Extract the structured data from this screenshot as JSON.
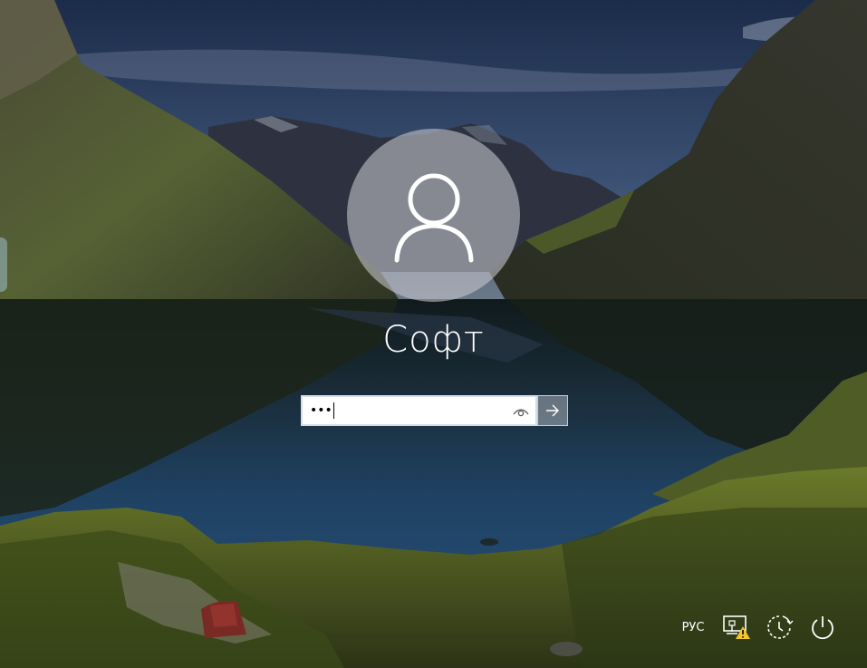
{
  "user": {
    "name": "Софт"
  },
  "password": {
    "masked_value": "•••",
    "reveal_icon": "eye-icon"
  },
  "submit": {
    "icon": "arrow-right-icon"
  },
  "tray": {
    "language": "РУС",
    "network_icon": "network-warning-icon",
    "accessibility_icon": "ease-of-access-icon",
    "power_icon": "power-icon"
  },
  "colors": {
    "sky_top": "#1e2f4d",
    "water": "#1d3a55",
    "mountain": "#3d3e2c",
    "grass": "#5a6a26",
    "warning": "#f3c52a"
  }
}
